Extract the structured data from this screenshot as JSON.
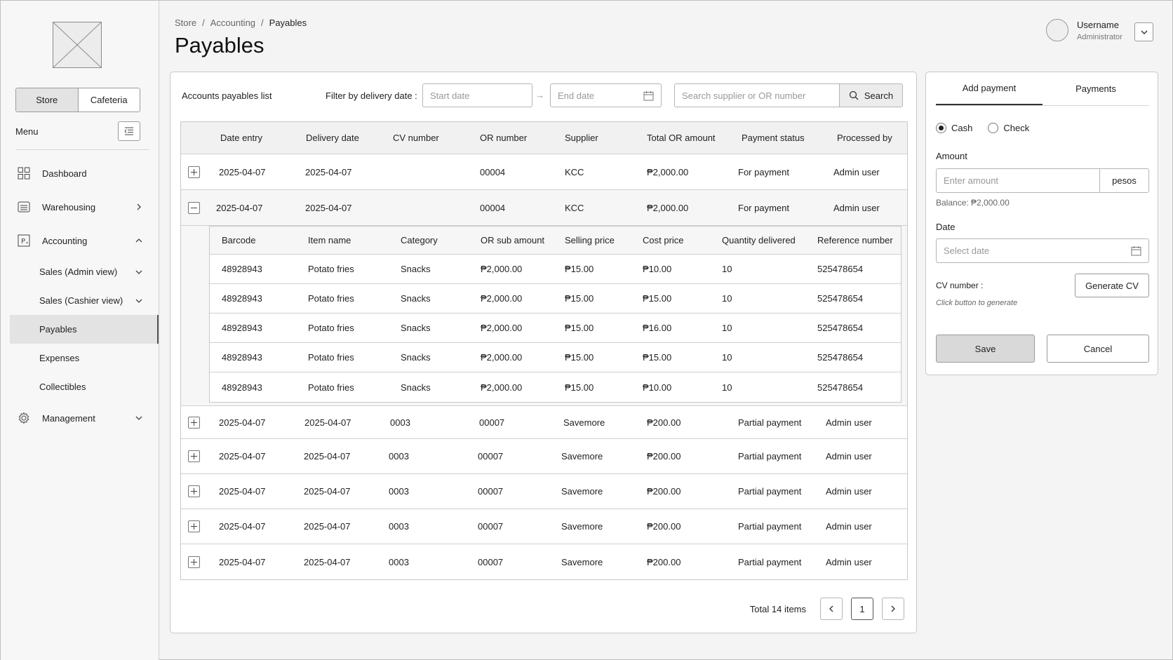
{
  "sidebar": {
    "store_switch": [
      "Store",
      "Cafeteria"
    ],
    "menu_label": "Menu",
    "nav": {
      "dashboard": "Dashboard",
      "warehousing": "Warehousing",
      "accounting": "Accounting",
      "sales_admin": "Sales (Admin view)",
      "sales_cashier": "Sales (Cashier view)",
      "payables": "Payables",
      "expenses": "Expenses",
      "collectibles": "Collectibles",
      "management": "Management"
    }
  },
  "header": {
    "breadcrumb": [
      "Store",
      "Accounting",
      "Payables"
    ],
    "separator": "/",
    "title": "Payables",
    "user_name": "Username",
    "user_role": "Administrator"
  },
  "list": {
    "title": "Accounts payables list",
    "filter_label": "Filter by delivery date :",
    "start_placeholder": "Start date",
    "range_arrow": "→",
    "end_placeholder": "End date",
    "search_placeholder": "Search supplier or OR number",
    "search_label": "Search",
    "columns": [
      "Date entry",
      "Delivery date",
      "CV number",
      "OR number",
      "Supplier",
      "Total OR amount",
      "Payment status",
      "Processed by"
    ],
    "rows": [
      {
        "date_entry": "2025-04-07",
        "delivery_date": "2025-04-07",
        "cv": "",
        "or": "00004",
        "supplier": "KCC",
        "total": "₱2,000.00",
        "status": "For payment",
        "by": "Admin user"
      },
      {
        "date_entry": "2025-04-07",
        "delivery_date": "2025-04-07",
        "cv": "",
        "or": "00004",
        "supplier": "KCC",
        "total": "₱2,000.00",
        "status": "For payment",
        "by": "Admin user"
      },
      {
        "date_entry": "2025-04-07",
        "delivery_date": "2025-04-07",
        "cv": "0003",
        "or": "00007",
        "supplier": "Savemore",
        "total": "₱200.00",
        "status": "Partial payment",
        "by": "Admin user"
      },
      {
        "date_entry": "2025-04-07",
        "delivery_date": "2025-04-07",
        "cv": "0003",
        "or": "00007",
        "supplier": "Savemore",
        "total": "₱200.00",
        "status": "Partial payment",
        "by": "Admin user"
      },
      {
        "date_entry": "2025-04-07",
        "delivery_date": "2025-04-07",
        "cv": "0003",
        "or": "00007",
        "supplier": "Savemore",
        "total": "₱200.00",
        "status": "Partial payment",
        "by": "Admin user"
      },
      {
        "date_entry": "2025-04-07",
        "delivery_date": "2025-04-07",
        "cv": "0003",
        "or": "00007",
        "supplier": "Savemore",
        "total": "₱200.00",
        "status": "Partial payment",
        "by": "Admin user"
      },
      {
        "date_entry": "2025-04-07",
        "delivery_date": "2025-04-07",
        "cv": "0003",
        "or": "00007",
        "supplier": "Savemore",
        "total": "₱200.00",
        "status": "Partial payment",
        "by": "Admin user"
      }
    ],
    "nested_columns": [
      "Barcode",
      "Item name",
      "Category",
      "OR sub amount",
      "Selling price",
      "Cost price",
      "Quantity delivered",
      "Reference number"
    ],
    "nested_rows": [
      {
        "barcode": "48928943",
        "item": "Potato fries",
        "category": "Snacks",
        "sub": "₱2,000.00",
        "sell": "₱15.00",
        "cost": "₱10.00",
        "qty": "10",
        "ref": "525478654"
      },
      {
        "barcode": "48928943",
        "item": "Potato fries",
        "category": "Snacks",
        "sub": "₱2,000.00",
        "sell": "₱15.00",
        "cost": "₱15.00",
        "qty": "10",
        "ref": "525478654"
      },
      {
        "barcode": "48928943",
        "item": "Potato fries",
        "category": "Snacks",
        "sub": "₱2,000.00",
        "sell": "₱15.00",
        "cost": "₱16.00",
        "qty": "10",
        "ref": "525478654"
      },
      {
        "barcode": "48928943",
        "item": "Potato fries",
        "category": "Snacks",
        "sub": "₱2,000.00",
        "sell": "₱15.00",
        "cost": "₱15.00",
        "qty": "10",
        "ref": "525478654"
      },
      {
        "barcode": "48928943",
        "item": "Potato fries",
        "category": "Snacks",
        "sub": "₱2,000.00",
        "sell": "₱15.00",
        "cost": "₱10.00",
        "qty": "10",
        "ref": "525478654"
      }
    ],
    "pagination": {
      "total": "Total 14 items",
      "page": "1"
    }
  },
  "payment": {
    "tabs": [
      "Add payment",
      "Payments"
    ],
    "methods": [
      "Cash",
      "Check"
    ],
    "selected_method": "Cash",
    "amount_label": "Amount",
    "amount_placeholder": "Enter amount",
    "amount_unit": "pesos",
    "balance": "Balance: ₱2,000.00",
    "date_label": "Date",
    "date_placeholder": "Select date",
    "cv_label": "CV number :",
    "cv_hint": "Click button to generate",
    "generate_label": "Generate CV",
    "save_label": "Save",
    "cancel_label": "Cancel"
  },
  "icons": {
    "logo": "image-placeholder-icon",
    "menu": "list-menu-icon",
    "dashboard": "grid-icon",
    "warehousing": "warehouse-icon",
    "accounting": "ledger-icon",
    "management": "gear-icon",
    "calendar": "calendar-icon",
    "search": "search-icon"
  }
}
